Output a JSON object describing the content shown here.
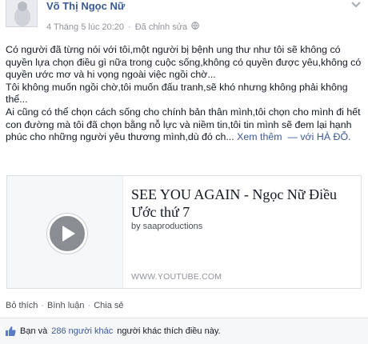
{
  "post": {
    "author": "Võ Thị Ngọc Nữ",
    "timestamp": "4 Tháng 5 lúc 20:20",
    "edited": "Đã chỉnh sửa",
    "privacy_icon": "globe-icon",
    "menu_icon": "chevron-down-icon",
    "text": {
      "p1": "Có người đã từng nói với tôi,một người bị bệnh ung thư như tôi sẽ không có quyền lựa chọn điều gì nữa trong cuộc sống,không có quyền được yêu,không có quyền ước mơ và hi vọng ngoài việc ngồi chờ...",
      "p2": "Tôi không muốn ngồi chờ,tôi muốn đấu tranh,sẽ khó nhưng không phải không thể...",
      "p3": "Ai cũng có thể chọn cách sống cho chính bản thân mình,tôi chọn cho mình đi hết con đường mà tôi đã chọn bằng nỗ lực và niềm tin,tôi tin mình sẽ đem lại hạnh phúc cho những người yêu thương mình,dù đó ch...",
      "see_more": "Xem thêm",
      "with_prefix": "— với",
      "with_place": "HÀ ĐỖ."
    }
  },
  "shared_video": {
    "title": "SEE YOU AGAIN - Ngọc Nữ Điều Ước thứ 7",
    "byline": "by saaproductions",
    "domain": "WWW.YOUTUBE.COM",
    "play_icon": "play-icon"
  },
  "actions": {
    "like": "Bỏ thích",
    "comment": "Bình luận",
    "share": "Chia sẻ",
    "separator": "·"
  },
  "likes": {
    "you_and": "Bạn và",
    "count": "286 người khác",
    "suffix": "người khác thích điều này.",
    "icon": "thumbs-up-icon"
  }
}
